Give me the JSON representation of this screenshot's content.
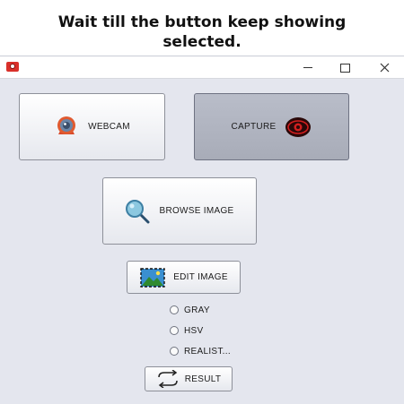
{
  "caption": {
    "line1": "Wait till the button keep showing",
    "line2": "selected."
  },
  "window": {
    "icon": "camera-icon",
    "controls": {
      "minimize": "minimize-icon",
      "maximize": "maximize-icon",
      "close": "close-icon"
    }
  },
  "buttons": {
    "webcam": {
      "label": "WEBCAM",
      "icon": "webcam-icon",
      "pressed": false
    },
    "capture": {
      "label": "CAPTURE",
      "icon": "eye-icon",
      "pressed": true
    },
    "browse": {
      "label": "BROWSE IMAGE",
      "icon": "magnifier-icon"
    },
    "edit": {
      "label": "EDIT IMAGE",
      "icon": "image-edit-icon"
    },
    "result": {
      "label": "RESULT",
      "icon": "refresh-icon"
    }
  },
  "radios": [
    {
      "label": "GRAY",
      "checked": false
    },
    {
      "label": "HSV",
      "checked": false
    },
    {
      "label": "REALIST...",
      "checked": false
    }
  ],
  "colors": {
    "window_bg": "#e4e6ee",
    "pressed_button": "#aeb2be",
    "capture_icon_red": "#d11f1f"
  }
}
